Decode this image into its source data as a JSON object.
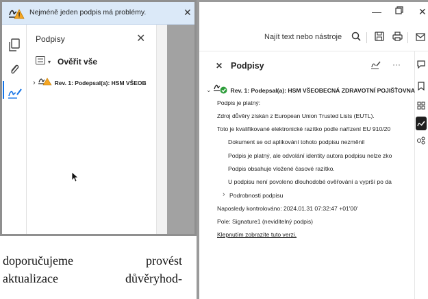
{
  "left": {
    "banner_text": "Nejméně jeden podpis má problémy.",
    "panel_title": "Podpisy",
    "verify_all_label": "Ověřit vše",
    "revision_label": "Rev. 1: Podepsal(a): HSM VŠEOB",
    "paragraph_line1": "doporučujeme provést",
    "paragraph_line2": "aktualizace důvěryhod-"
  },
  "right": {
    "find_placeholder": "Najít text nebo nástroje",
    "panel_title": "Podpisy",
    "revision_label": "Rev. 1: Podepsal(a): HSM VŠEOBECNÁ ZDRAVOTNÍ POJIŠŤOVNA",
    "details": [
      "Podpis je platný:",
      "Zdroj důvěry získán z European Union Trusted Lists (EUTL).",
      "Toto je kvalifikované elektronické razítko podle nařízení EU 910/20",
      "Dokument se od aplikování tohoto podpisu nezměnil",
      "Podpis je platný, ale odvolání identity autora podpisu nelze zko",
      "Podpis obsahuje vložené časové razítko.",
      "U podpisu není povoleno dlouhodobé ověřování a vyprší po da",
      "Podrobnosti podpisu",
      "Naposledy kontrolováno: 2024.01.31 07:32:47 +01'00'",
      "Pole: Signature1 (neviditelný podpis)",
      "Klepnutím zobrazíte tuto verzi."
    ]
  },
  "colors": {
    "banner_bg": "#dbe9f8",
    "warning": "#f5a623",
    "accent_blue": "#1473e6",
    "valid_green": "#2d9d3a"
  },
  "icons": [
    "signature-warning-icon",
    "close-icon",
    "pages-icon",
    "attachment-icon",
    "signature-pen-icon",
    "list-icon",
    "chevron-down-icon",
    "chevron-right-icon",
    "signature-valid-icon",
    "search-icon",
    "save-icon",
    "print-icon",
    "email-icon",
    "minimize-icon",
    "maximize-icon",
    "more-icon",
    "signature-edit-icon",
    "comment-icon",
    "bookmark-icon",
    "grid-icon",
    "pen-icon",
    "share-icon",
    "mouse-cursor-icon"
  ]
}
